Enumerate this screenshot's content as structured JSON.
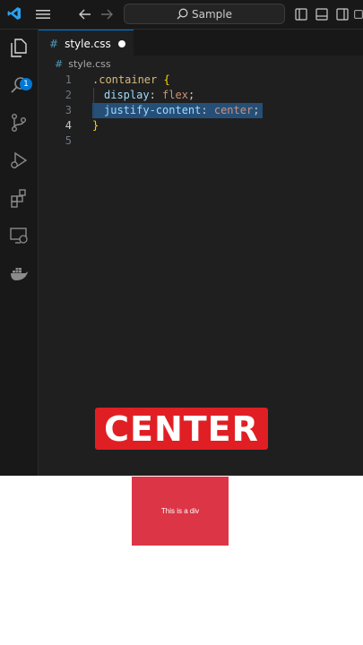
{
  "titlebar": {
    "search_placeholder": "Sample"
  },
  "activity": {
    "explorer_badge": "1"
  },
  "tab": {
    "hash": "#",
    "filename": "style.css"
  },
  "breadcrumb": {
    "hash": "#",
    "filename": "style.css"
  },
  "editor": {
    "line_numbers": [
      "1",
      "2",
      "3",
      "4",
      "5"
    ],
    "line1": {
      "selector": ".container",
      "brace": "{"
    },
    "line2": {
      "prop": "display",
      "colon": ":",
      "value": "flex",
      "semi": ";"
    },
    "line3": {
      "prop": "justify-content",
      "colon": ":",
      "value": "center",
      "semi": ";"
    },
    "line4": {
      "brace": "}"
    }
  },
  "banner": {
    "text": "CENTER"
  },
  "preview": {
    "box_text": "This is a div"
  },
  "colors": {
    "accent": "#0078d4",
    "banner": "#e01f24",
    "box": "#dc3545"
  },
  "icons": [
    "vscode-logo-icon",
    "menu-icon",
    "back-arrow-icon",
    "forward-arrow-icon",
    "search-icon",
    "layout-sidebar-icon",
    "layout-panel-icon",
    "layout-secondary-icon",
    "layout-custom-icon",
    "explorer-icon",
    "search-view-icon",
    "source-control-icon",
    "run-debug-icon",
    "extensions-icon",
    "remote-explorer-icon",
    "docker-icon"
  ]
}
